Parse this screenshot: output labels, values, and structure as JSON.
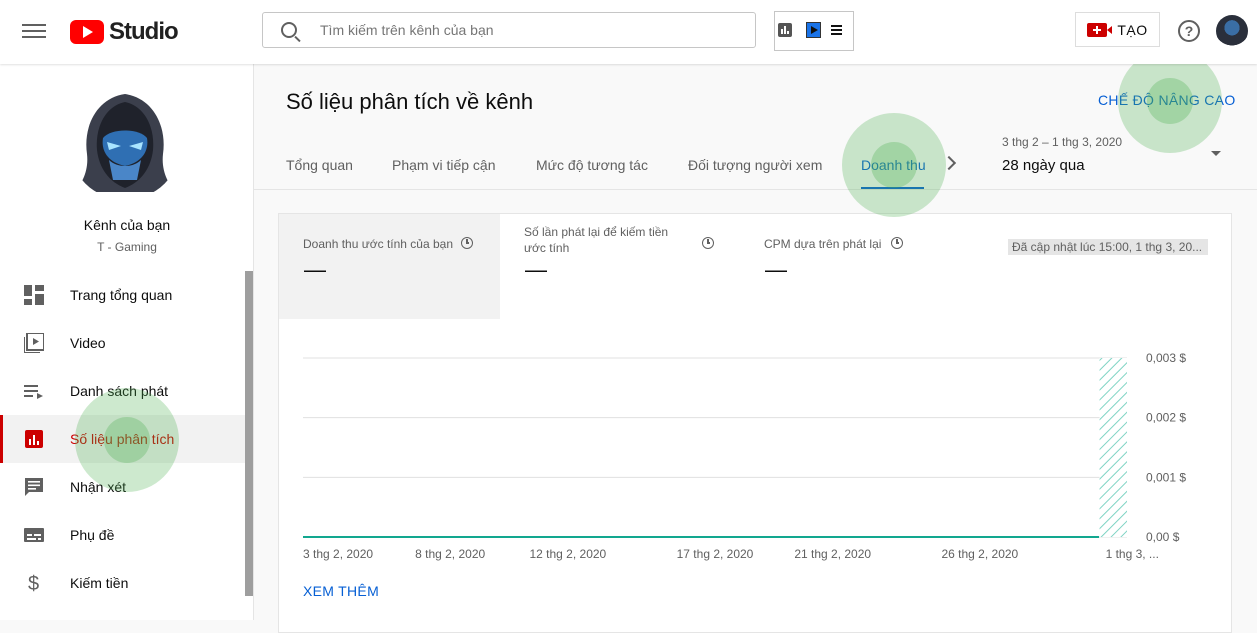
{
  "app": {
    "logo_text": "Studio"
  },
  "search": {
    "placeholder": "Tìm kiếm trên kênh của bạn"
  },
  "header": {
    "create_label": "TẠO",
    "help_label": "?"
  },
  "channel": {
    "name": "Kênh của bạn",
    "subtitle": "T - Gaming"
  },
  "sidebar": {
    "items": [
      {
        "label": "Trang tổng quan",
        "icon": "dashboard-icon"
      },
      {
        "label": "Video",
        "icon": "video-icon"
      },
      {
        "label": "Danh sách phát",
        "icon": "playlist-icon"
      },
      {
        "label": "Số liệu phân tích",
        "icon": "analytics-icon",
        "active": true
      },
      {
        "label": "Nhận xét",
        "icon": "comments-icon"
      },
      {
        "label": "Phụ đề",
        "icon": "subtitles-icon"
      },
      {
        "label": "Kiếm tiền",
        "icon": "dollar-icon"
      }
    ]
  },
  "main": {
    "title": "Số liệu phân tích về kênh",
    "advanced_label": "CHẾ ĐỘ NÂNG CAO",
    "tabs": [
      {
        "label": "Tổng quan"
      },
      {
        "label": "Phạm vi tiếp cận"
      },
      {
        "label": "Mức độ tương tác"
      },
      {
        "label": "Đối tượng người xem"
      },
      {
        "label": "Doanh thu",
        "active": true
      }
    ],
    "date_range": "3 thg 2 – 1 thg 3, 2020",
    "period": "28 ngày qua",
    "metrics": [
      {
        "label": "Doanh thu ước tính của bạn",
        "value": "—"
      },
      {
        "label": "Số lần phát lại để kiếm tiền ước tính",
        "value": "—"
      },
      {
        "label": "CPM dựa trên phát lại",
        "value": "—"
      }
    ],
    "updated": "Đã cập nhật lúc 15:00, 1 thg 3, 20...",
    "see_more": "XEM THÊM"
  },
  "colors": {
    "accent": "#065fd4",
    "active": "#cc0000",
    "series": "#12a78f"
  },
  "chart_data": {
    "type": "line",
    "x_ticks": [
      "3 thg 2, 2020",
      "8 thg 2, 2020",
      "12 thg 2, 2020",
      "17 thg 2, 2020",
      "21 thg 2, 2020",
      "26 thg 2, 2020",
      "1 thg 3, ..."
    ],
    "y_ticks": [
      "0,003 $",
      "0,002 $",
      "0,001 $",
      "0,00 $"
    ],
    "ylim": [
      0,
      0.003
    ],
    "values": [
      0,
      0,
      0,
      0,
      0,
      0,
      0,
      0,
      0,
      0,
      0,
      0,
      0,
      0,
      0,
      0,
      0,
      0,
      0,
      0,
      0,
      0,
      0,
      0,
      0,
      0,
      0,
      0
    ],
    "highlight": {
      "label": "1 thg 3, ...",
      "pattern": "hatched",
      "range_y": [
        0,
        0.003
      ]
    },
    "grid": true
  }
}
